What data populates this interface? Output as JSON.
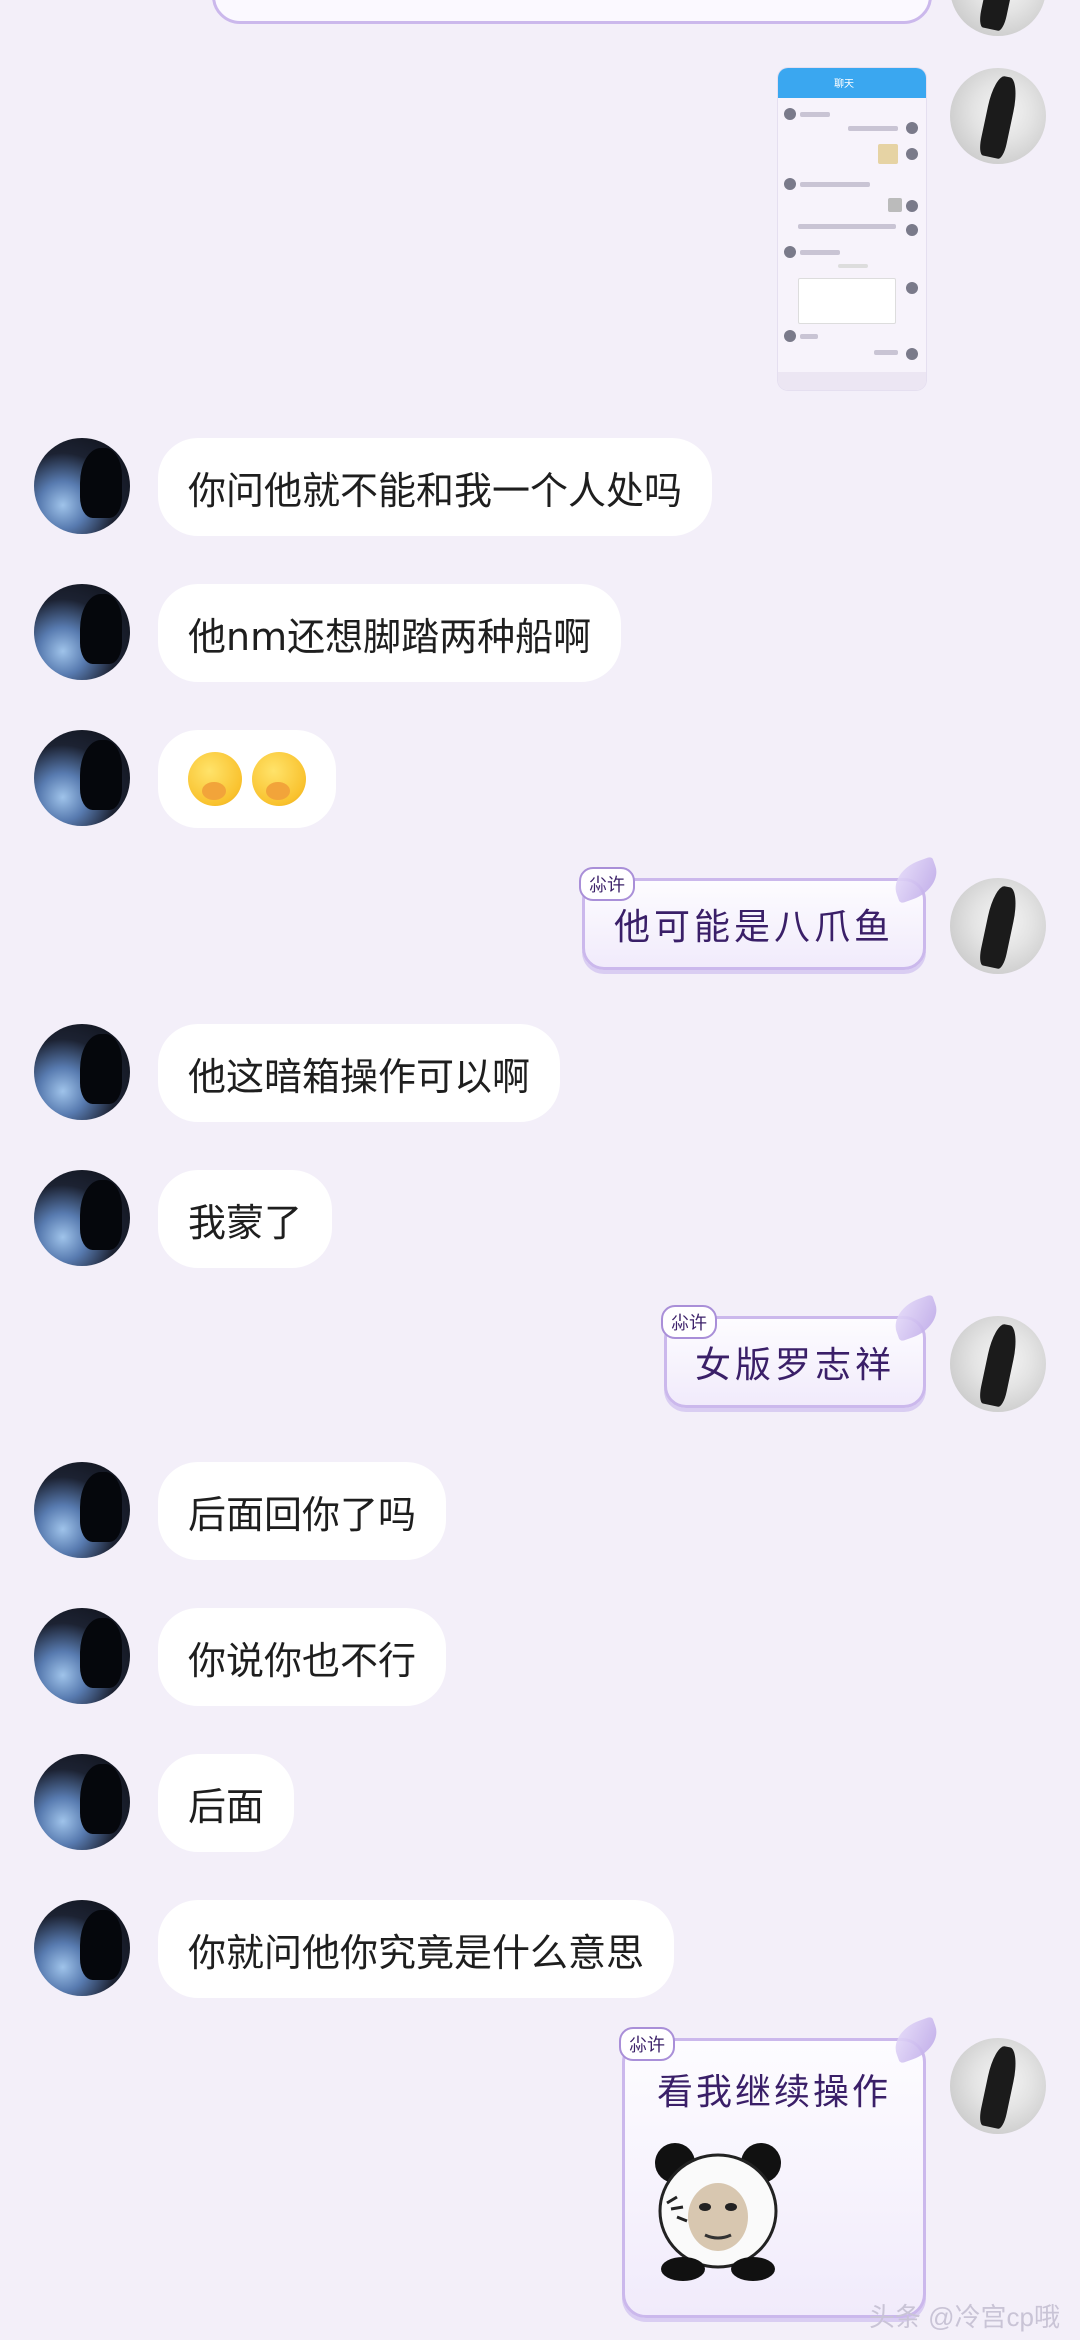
{
  "messages_left": [
    {
      "text": "你问他就不能和我一个人处吗"
    },
    {
      "text": "他nm还想脚踏两种船啊"
    },
    {
      "text": ""
    },
    {
      "text": "他这暗箱操作可以啊"
    },
    {
      "text": "我蒙了"
    },
    {
      "text": "后面回你了吗"
    },
    {
      "text": "你说你也不行"
    },
    {
      "text": "后面"
    },
    {
      "text": "你就问他你究竟是什么意思"
    }
  ],
  "messages_right": [
    {
      "tag": "尛许",
      "text": "他可能是八爪鱼"
    },
    {
      "tag": "尛许",
      "text": "女版罗志祥"
    },
    {
      "tag": "尛许",
      "text": "看我继续操作"
    }
  ],
  "emoji_message": {
    "icons": [
      "hand-over-mouth-emoji",
      "hand-over-mouth-emoji"
    ]
  },
  "thumbnail": {
    "title": "聊天"
  },
  "watermark": "头条 @冷宫cp哦"
}
